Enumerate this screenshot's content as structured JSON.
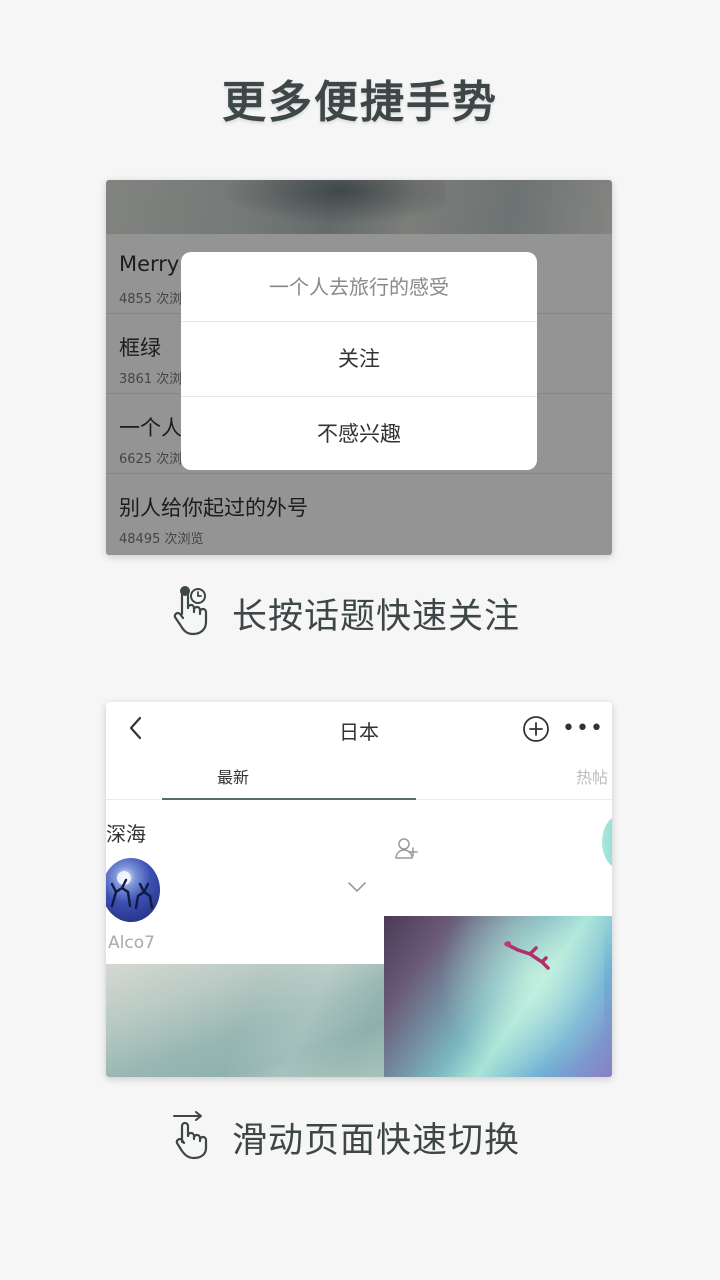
{
  "headline": "更多便捷手势",
  "card1": {
    "topics": [
      {
        "title": "Merry",
        "count": "4855 次浏"
      },
      {
        "title": "框绿",
        "count": "3861 次浏"
      },
      {
        "title": "一个人",
        "count": "6625 次浏"
      },
      {
        "title": "别人给你起过的外号",
        "count": "48495 次浏览"
      }
    ],
    "dialog": {
      "title": "一个人去旅行的感受",
      "follow_label": "关注",
      "not_interested_label": "不感兴趣"
    }
  },
  "caption1": {
    "text": "长按话题快速关注",
    "icon": "long-press-hand-icon"
  },
  "card2": {
    "nav_title": "日本",
    "tabs": [
      {
        "label": "最新",
        "active": true
      },
      {
        "label": "热帖",
        "active": false
      }
    ],
    "post_title": "深海",
    "username": "Alco7",
    "more_glyph": "•••"
  },
  "caption2": {
    "text": "滑动页面快速切换",
    "icon": "swipe-hand-icon"
  },
  "colors": {
    "background": "#f6f6f6",
    "text": "#3e4748",
    "accent": "#5a6b6c"
  }
}
